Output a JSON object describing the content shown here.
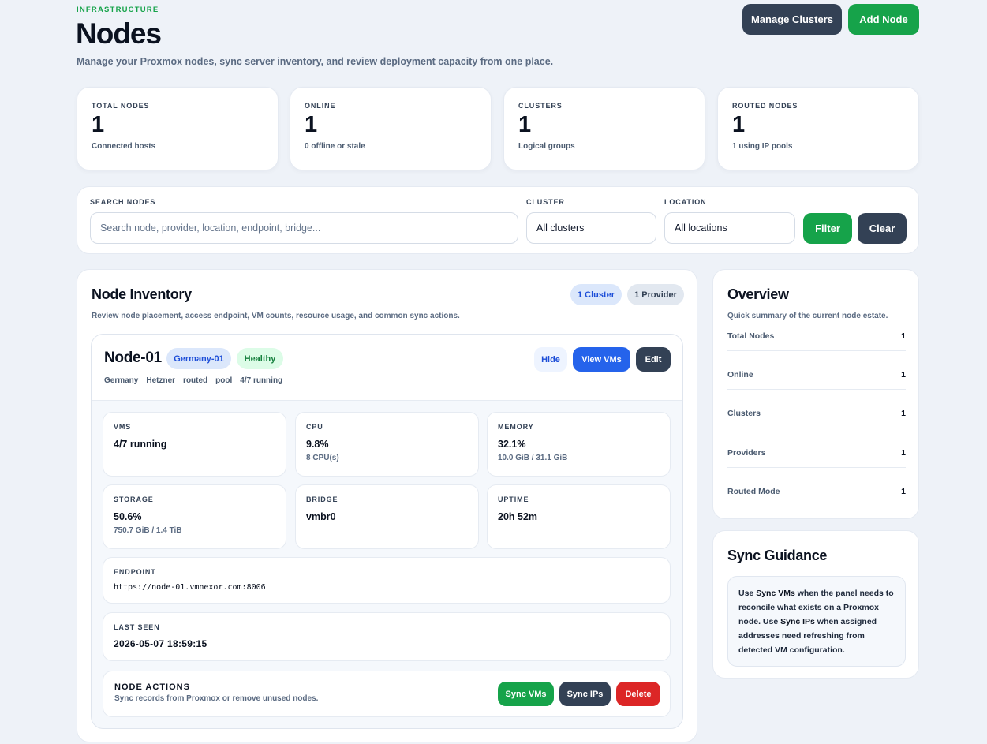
{
  "header": {
    "eyebrow": "INFRASTRUCTURE",
    "title": "Nodes",
    "subtitle": "Manage your Proxmox nodes, sync server inventory, and review deployment capacity from one place.",
    "manage_clusters_label": "Manage Clusters",
    "add_node_label": "Add Node"
  },
  "stats": [
    {
      "label": "TOTAL NODES",
      "value": "1",
      "note": "Connected hosts"
    },
    {
      "label": "ONLINE",
      "value": "1",
      "note": "0 offline or stale"
    },
    {
      "label": "CLUSTERS",
      "value": "1",
      "note": "Logical groups"
    },
    {
      "label": "ROUTED NODES",
      "value": "1",
      "note": "1 using IP pools"
    }
  ],
  "filters": {
    "search_label": "SEARCH NODES",
    "search_placeholder": "Search node, provider, location, endpoint, bridge...",
    "cluster_label": "CLUSTER",
    "cluster_value": "All clusters",
    "location_label": "LOCATION",
    "location_value": "All locations",
    "filter_label": "Filter",
    "clear_label": "Clear"
  },
  "inventory": {
    "title": "Node Inventory",
    "subtitle": "Review node placement, access endpoint, VM counts, resource usage, and common sync actions.",
    "cluster_pill": "1 Cluster",
    "provider_pill": "1 Provider"
  },
  "node": {
    "name": "Node-01",
    "cluster_badge": "Germany-01",
    "status_badge": "Healthy",
    "meta": [
      "Germany",
      "Hetzner",
      "routed",
      "pool",
      "4/7 running"
    ],
    "hide_label": "Hide",
    "view_vms_label": "View VMs",
    "edit_label": "Edit",
    "metrics": {
      "vms": {
        "label": "VMS",
        "value": "4/7 running",
        "note": ""
      },
      "cpu": {
        "label": "CPU",
        "value": "9.8%",
        "note": "8 CPU(s)"
      },
      "memory": {
        "label": "MEMORY",
        "value": "32.1%",
        "note": "10.0 GiB / 31.1 GiB"
      },
      "storage": {
        "label": "STORAGE",
        "value": "50.6%",
        "note": "750.7 GiB / 1.4 TiB"
      },
      "bridge": {
        "label": "BRIDGE",
        "value": "vmbr0",
        "note": ""
      },
      "uptime": {
        "label": "UPTIME",
        "value": "20h 52m",
        "note": ""
      }
    },
    "endpoint_label": "ENDPOINT",
    "endpoint": "https://node-01.vmnexor.com:8006",
    "last_seen_label": "LAST SEEN",
    "last_seen": "2026-05-07 18:59:15",
    "actions_title": "NODE ACTIONS",
    "actions_sub": "Sync records from Proxmox or remove unused nodes.",
    "sync_vms_label": "Sync VMs",
    "sync_ips_label": "Sync IPs",
    "delete_label": "Delete"
  },
  "overview": {
    "title": "Overview",
    "subtitle": "Quick summary of the current node estate.",
    "rows": [
      {
        "label": "Total Nodes",
        "value": "1"
      },
      {
        "label": "Online",
        "value": "1"
      },
      {
        "label": "Clusters",
        "value": "1"
      },
      {
        "label": "Providers",
        "value": "1"
      },
      {
        "label": "Routed Mode",
        "value": "1"
      }
    ]
  },
  "guidance": {
    "title": "Sync Guidance",
    "t1": "Use ",
    "b1": "Sync VMs",
    "t2": " when the panel needs to reconcile what exists on a Proxmox node. Use ",
    "b2": "Sync IPs",
    "t3": " when assigned addresses need refreshing from detected VM configuration."
  },
  "colors": {
    "accent_green": "#16a34a",
    "dark": "#334155",
    "blue": "#2563eb",
    "red": "#dc2626",
    "background": "#eef2f8"
  }
}
